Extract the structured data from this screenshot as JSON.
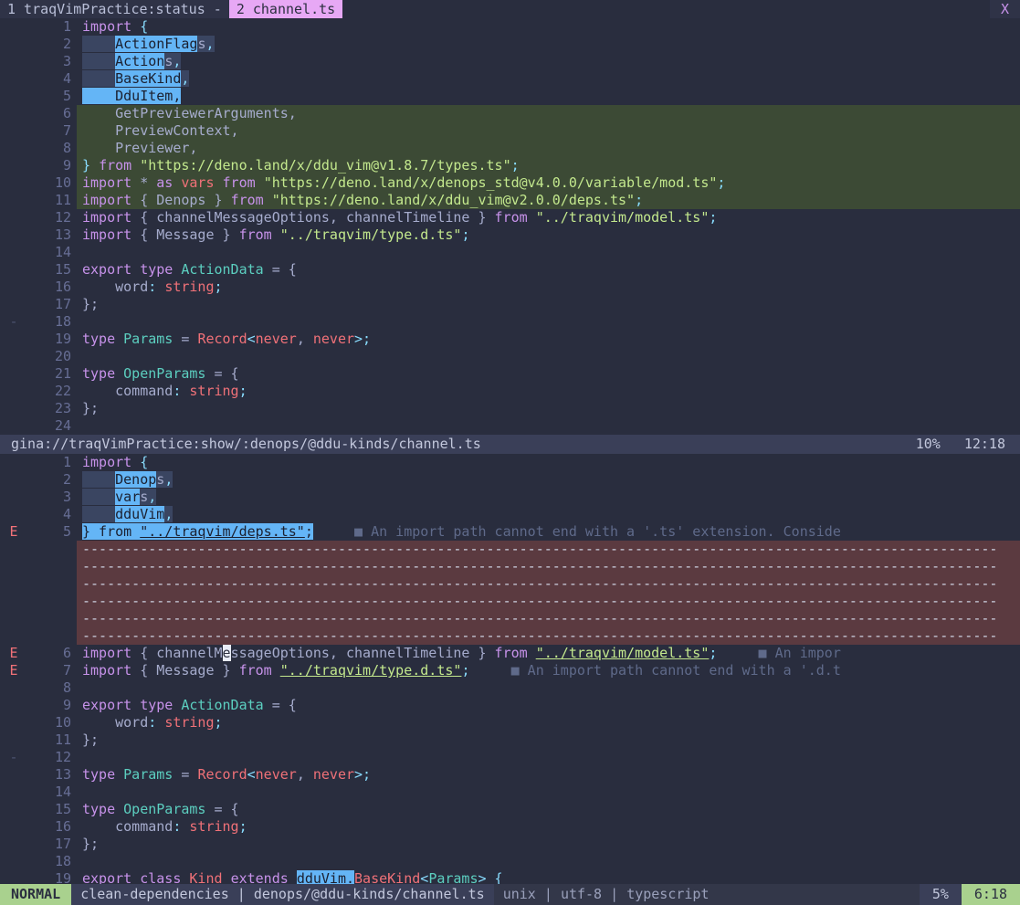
{
  "tabline": {
    "tabs": [
      {
        "label": "1 traqVimPractice:status -",
        "selected": false
      },
      {
        "label": "2 channel.ts",
        "selected": true
      }
    ],
    "close_label": "X"
  },
  "top_buffer": {
    "lines": [
      {
        "num": "1",
        "sign": "",
        "segments": [
          {
            "t": "import ",
            "c": "kw"
          },
          {
            "t": "{",
            "c": "p"
          }
        ]
      },
      {
        "num": "2",
        "sign": "",
        "segments": [
          {
            "t": "    ",
            "c": "vis"
          },
          {
            "t": "ActionFlag",
            "c": "srch"
          },
          {
            "t": "s",
            "c": "vis"
          },
          {
            "t": ",",
            "c": "vis p"
          }
        ]
      },
      {
        "num": "3",
        "sign": "",
        "segments": [
          {
            "t": "    ",
            "c": "vis"
          },
          {
            "t": "Action",
            "c": "srch"
          },
          {
            "t": "s",
            "c": "vis"
          },
          {
            "t": ",",
            "c": "vis p"
          }
        ]
      },
      {
        "num": "4",
        "sign": "",
        "segments": [
          {
            "t": "    ",
            "c": "vis"
          },
          {
            "t": "BaseKind",
            "c": "srch"
          },
          {
            "t": ",",
            "c": "vis p"
          }
        ]
      },
      {
        "num": "5",
        "sign": "",
        "segments": [
          {
            "t": "    DduItem,",
            "c": "srch"
          }
        ]
      },
      {
        "num": "6",
        "sign": "",
        "bg": "add",
        "segments": [
          {
            "t": "    GetPreviewerArguments,",
            "c": "pl"
          }
        ]
      },
      {
        "num": "7",
        "sign": "",
        "bg": "add",
        "segments": [
          {
            "t": "    PreviewContext,",
            "c": "pl"
          }
        ]
      },
      {
        "num": "8",
        "sign": "",
        "bg": "add",
        "segments": [
          {
            "t": "    Previewer,",
            "c": "pl"
          }
        ]
      },
      {
        "num": "9",
        "sign": "",
        "bg": "add",
        "segments": [
          {
            "t": "}",
            "c": "p"
          },
          {
            "t": " ",
            "c": "pl"
          },
          {
            "t": "from",
            "c": "kw"
          },
          {
            "t": " ",
            "c": "pl"
          },
          {
            "t": "\"https://deno.land/x/ddu_vim@v1.8.7/types.ts\"",
            "c": "str"
          },
          {
            "t": ";",
            "c": "p"
          }
        ]
      },
      {
        "num": "10",
        "sign": "",
        "bg": "add",
        "segments": [
          {
            "t": "import",
            "c": "kw"
          },
          {
            "t": " * ",
            "c": "pl"
          },
          {
            "t": "as",
            "c": "kw"
          },
          {
            "t": " ",
            "c": "pl"
          },
          {
            "t": "vars",
            "c": "red"
          },
          {
            "t": " ",
            "c": "pl"
          },
          {
            "t": "from",
            "c": "kw"
          },
          {
            "t": " ",
            "c": "pl"
          },
          {
            "t": "\"https://deno.land/x/denops_std@v4.0.0/variable/mod.ts\"",
            "c": "str"
          },
          {
            "t": ";",
            "c": "p"
          }
        ]
      },
      {
        "num": "11",
        "sign": "",
        "bg": "add",
        "segments": [
          {
            "t": "import",
            "c": "kw"
          },
          {
            "t": " { ",
            "c": "pl"
          },
          {
            "t": "Denops",
            "c": "pl"
          },
          {
            "t": " } ",
            "c": "pl"
          },
          {
            "t": "from",
            "c": "kw"
          },
          {
            "t": " ",
            "c": "pl"
          },
          {
            "t": "\"https://deno.land/x/ddu_vim@v2.0.0/deps.ts\"",
            "c": "str"
          },
          {
            "t": ";",
            "c": "p"
          }
        ]
      },
      {
        "num": "12",
        "sign": "",
        "segments": [
          {
            "t": "import",
            "c": "kw"
          },
          {
            "t": " { channelMessageOptions, channelTimeline } ",
            "c": "pl"
          },
          {
            "t": "from",
            "c": "kw"
          },
          {
            "t": " ",
            "c": "pl"
          },
          {
            "t": "\"../traqvim/model.ts\"",
            "c": "str"
          },
          {
            "t": ";",
            "c": "p"
          }
        ]
      },
      {
        "num": "13",
        "sign": "",
        "segments": [
          {
            "t": "import",
            "c": "kw"
          },
          {
            "t": " { Message } ",
            "c": "pl"
          },
          {
            "t": "from",
            "c": "kw"
          },
          {
            "t": " ",
            "c": "pl"
          },
          {
            "t": "\"../traqvim/type.d.ts\"",
            "c": "str"
          },
          {
            "t": ";",
            "c": "p"
          }
        ]
      },
      {
        "num": "14",
        "sign": "",
        "segments": []
      },
      {
        "num": "15",
        "sign": "",
        "segments": [
          {
            "t": "export type",
            "c": "kw"
          },
          {
            "t": " ",
            "c": "pl"
          },
          {
            "t": "ActionData",
            "c": "type"
          },
          {
            "t": " = {",
            "c": "pl"
          }
        ]
      },
      {
        "num": "16",
        "sign": "",
        "segments": [
          {
            "t": "    word",
            "c": "pl"
          },
          {
            "t": ": ",
            "c": "p"
          },
          {
            "t": "string",
            "c": "red"
          },
          {
            "t": ";",
            "c": "p"
          }
        ]
      },
      {
        "num": "17",
        "sign": "",
        "segments": [
          {
            "t": "};",
            "c": "pl"
          }
        ]
      },
      {
        "num": "18",
        "sign": "-",
        "segments": []
      },
      {
        "num": "19",
        "sign": "",
        "segments": [
          {
            "t": "type",
            "c": "kw"
          },
          {
            "t": " ",
            "c": "pl"
          },
          {
            "t": "Params",
            "c": "type"
          },
          {
            "t": " = ",
            "c": "pl"
          },
          {
            "t": "Record",
            "c": "red"
          },
          {
            "t": "<",
            "c": "p"
          },
          {
            "t": "never",
            "c": "red"
          },
          {
            "t": ", ",
            "c": "pl"
          },
          {
            "t": "never",
            "c": "red"
          },
          {
            "t": ">;",
            "c": "p"
          }
        ]
      },
      {
        "num": "20",
        "sign": "",
        "segments": []
      },
      {
        "num": "21",
        "sign": "",
        "segments": [
          {
            "t": "type",
            "c": "kw"
          },
          {
            "t": " ",
            "c": "pl"
          },
          {
            "t": "OpenParams",
            "c": "type"
          },
          {
            "t": " = {",
            "c": "pl"
          }
        ]
      },
      {
        "num": "22",
        "sign": "",
        "segments": [
          {
            "t": "    command",
            "c": "pl"
          },
          {
            "t": ": ",
            "c": "p"
          },
          {
            "t": "string",
            "c": "red"
          },
          {
            "t": ";",
            "c": "p"
          }
        ]
      },
      {
        "num": "23",
        "sign": "",
        "segments": [
          {
            "t": "};",
            "c": "pl"
          }
        ]
      },
      {
        "num": "24",
        "sign": "",
        "segments": []
      }
    ]
  },
  "mid_status": {
    "path": "gina://traqVimPractice:show/:denops/@ddu-kinds/channel.ts",
    "percent": "10%",
    "position": "12:18"
  },
  "bottom_buffer": {
    "lines": [
      {
        "num": "1",
        "sign": "",
        "segments": [
          {
            "t": "import ",
            "c": "kw"
          },
          {
            "t": "{",
            "c": "p"
          }
        ]
      },
      {
        "num": "2",
        "sign": "",
        "segments": [
          {
            "t": "    ",
            "c": "vis"
          },
          {
            "t": "Denop",
            "c": "srch"
          },
          {
            "t": "s",
            "c": "vis"
          },
          {
            "t": ",",
            "c": "vis p"
          }
        ]
      },
      {
        "num": "3",
        "sign": "",
        "segments": [
          {
            "t": "    ",
            "c": "vis"
          },
          {
            "t": "var",
            "c": "srch"
          },
          {
            "t": "s",
            "c": "vis"
          },
          {
            "t": ",",
            "c": "vis p"
          }
        ]
      },
      {
        "num": "4",
        "sign": "",
        "segments": [
          {
            "t": "    ",
            "c": "vis"
          },
          {
            "t": "dduVim",
            "c": "srch"
          },
          {
            "t": ",",
            "c": "vis p"
          }
        ]
      },
      {
        "num": "5",
        "sign": "E",
        "segments": [
          {
            "t": "} from ",
            "c": "srch"
          },
          {
            "t": "\"../traqvim/deps.ts\"",
            "c": "srch ul"
          },
          {
            "t": ";",
            "c": "srch"
          },
          {
            "t": "     ",
            "c": "pl"
          },
          {
            "t": "■ An import path cannot end with a '.ts' extension. Conside",
            "c": "virt"
          }
        ]
      },
      {
        "type": "dash"
      },
      {
        "type": "dash"
      },
      {
        "type": "dash"
      },
      {
        "type": "dash"
      },
      {
        "type": "dash"
      },
      {
        "type": "dash"
      },
      {
        "num": "6",
        "sign": "E",
        "segments": [
          {
            "t": "import",
            "c": "kw"
          },
          {
            "t": " { channelM",
            "c": "pl"
          },
          {
            "t": "e",
            "c": "curs"
          },
          {
            "t": "ssageOptions, channelTimeline } ",
            "c": "pl"
          },
          {
            "t": "from",
            "c": "kw"
          },
          {
            "t": " ",
            "c": "pl"
          },
          {
            "t": "\"../traqvim/model.ts\"",
            "c": "str ul"
          },
          {
            "t": ";",
            "c": "p"
          },
          {
            "t": "     ",
            "c": "pl"
          },
          {
            "t": "■ An impor",
            "c": "virt"
          }
        ]
      },
      {
        "num": "7",
        "sign": "E",
        "segments": [
          {
            "t": "import",
            "c": "kw"
          },
          {
            "t": " { Message } ",
            "c": "pl"
          },
          {
            "t": "from",
            "c": "kw"
          },
          {
            "t": " ",
            "c": "pl"
          },
          {
            "t": "\"../traqvim/type.d.ts\"",
            "c": "str ul"
          },
          {
            "t": ";",
            "c": "p"
          },
          {
            "t": "     ",
            "c": "pl"
          },
          {
            "t": "■ An import path cannot end with a '.d.t",
            "c": "virt"
          }
        ]
      },
      {
        "num": "8",
        "sign": "",
        "segments": []
      },
      {
        "num": "9",
        "sign": "",
        "segments": [
          {
            "t": "export type",
            "c": "kw"
          },
          {
            "t": " ",
            "c": "pl"
          },
          {
            "t": "ActionData",
            "c": "type"
          },
          {
            "t": " = {",
            "c": "pl"
          }
        ]
      },
      {
        "num": "10",
        "sign": "",
        "segments": [
          {
            "t": "    word",
            "c": "pl"
          },
          {
            "t": ": ",
            "c": "p"
          },
          {
            "t": "string",
            "c": "red"
          },
          {
            "t": ";",
            "c": "p"
          }
        ]
      },
      {
        "num": "11",
        "sign": "",
        "segments": [
          {
            "t": "};",
            "c": "pl"
          }
        ]
      },
      {
        "num": "12",
        "sign": "-",
        "segments": []
      },
      {
        "num": "13",
        "sign": "",
        "segments": [
          {
            "t": "type",
            "c": "kw"
          },
          {
            "t": " ",
            "c": "pl"
          },
          {
            "t": "Params",
            "c": "type"
          },
          {
            "t": " = ",
            "c": "pl"
          },
          {
            "t": "Record",
            "c": "red"
          },
          {
            "t": "<",
            "c": "p"
          },
          {
            "t": "never",
            "c": "red"
          },
          {
            "t": ", ",
            "c": "pl"
          },
          {
            "t": "never",
            "c": "red"
          },
          {
            "t": ">;",
            "c": "p"
          }
        ]
      },
      {
        "num": "14",
        "sign": "",
        "segments": []
      },
      {
        "num": "15",
        "sign": "",
        "segments": [
          {
            "t": "type",
            "c": "kw"
          },
          {
            "t": " ",
            "c": "pl"
          },
          {
            "t": "OpenParams",
            "c": "type"
          },
          {
            "t": " = {",
            "c": "pl"
          }
        ]
      },
      {
        "num": "16",
        "sign": "",
        "segments": [
          {
            "t": "    command",
            "c": "pl"
          },
          {
            "t": ": ",
            "c": "p"
          },
          {
            "t": "string",
            "c": "red"
          },
          {
            "t": ";",
            "c": "p"
          }
        ]
      },
      {
        "num": "17",
        "sign": "",
        "segments": [
          {
            "t": "};",
            "c": "pl"
          }
        ]
      },
      {
        "num": "18",
        "sign": "",
        "segments": []
      },
      {
        "num": "19",
        "sign": "",
        "segments": [
          {
            "t": "export class",
            "c": "kw"
          },
          {
            "t": " ",
            "c": "pl"
          },
          {
            "t": "Kind",
            "c": "red"
          },
          {
            "t": " ",
            "c": "pl"
          },
          {
            "t": "extends",
            "c": "kw"
          },
          {
            "t": " ",
            "c": "pl"
          },
          {
            "t": "dduVim.",
            "c": "srch"
          },
          {
            "t": "BaseKind",
            "c": "red"
          },
          {
            "t": "<",
            "c": "p"
          },
          {
            "t": "Params",
            "c": "type"
          },
          {
            "t": "> {",
            "c": "p"
          }
        ]
      }
    ],
    "dash_text": "---------------------------------------------------------------------------------------------------------------"
  },
  "statusline": {
    "mode": "NORMAL",
    "branch": "clean-dependencies",
    "separator": "|",
    "filepath": "denops/@ddu-kinds/channel.ts",
    "fileformat": "unix",
    "encoding": "utf-8",
    "filetype": "typescript",
    "percent": "5%",
    "position": "6:18"
  },
  "colors": {
    "background": "#292d3e",
    "accent_purple": "#c792ea",
    "string_green": "#c3e88d",
    "search_blue": "#64b5f6",
    "error_bg": "#5b3a40",
    "diff_add_bg": "#3c4a35",
    "status_green": "#a9d18e",
    "tab_selected": "#e7a8f5"
  }
}
